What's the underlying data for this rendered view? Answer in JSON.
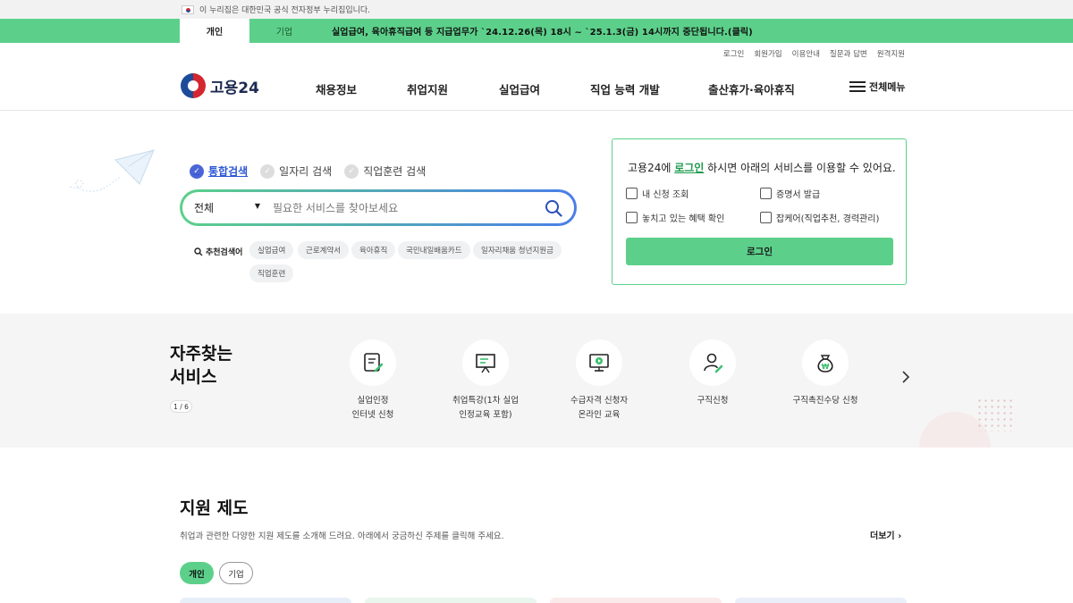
{
  "gov_strip": {
    "text": "이 누리집은 대한민국 공식 전자정부 누리집입니다."
  },
  "notice": {
    "tabs": [
      "개인",
      "기업"
    ],
    "message": "실업급여, 육아휴직급여 등 지급업무가 `24.12.26(목) 18시 ~ `25.1.3(금) 14시까지 중단됩니다.(클릭)"
  },
  "util_links": [
    "로그인",
    "회원가입",
    "이용안내",
    "질문과 답변",
    "원격지원"
  ],
  "header": {
    "logo_text": "고용24",
    "menu": [
      "채용정보",
      "취업지원",
      "실업급여",
      "직업 능력 개발",
      "출산휴가·육아휴직"
    ],
    "all_menu": "전체메뉴"
  },
  "search": {
    "tabs": [
      "통합검색",
      "일자리 검색",
      "직업훈련 검색"
    ],
    "select_value": "전체",
    "placeholder": "필요한 서비스를 찾아보세요",
    "recommend_label": "추천검색어",
    "keywords": [
      "실업급여",
      "근로계약서",
      "육아휴직",
      "국민내일배움카드",
      "일자리채움 청년지원금",
      "직업훈련"
    ]
  },
  "login_card": {
    "title_prefix": "고용24에 ",
    "title_link": "로그인",
    "title_suffix": " 하시면 아래의 서비스를 이용할 수 있어요.",
    "items": [
      "내 신청 조회",
      "증명서 발급",
      "놓치고 있는 혜택 확인",
      "잡케어(직업추천, 경력관리)"
    ],
    "button": "로그인"
  },
  "frequent": {
    "title_line1": "자주찾는",
    "title_line2": "서비스",
    "pager": "1 / 6",
    "services": [
      {
        "label": "실업인정\n인터넷 신청",
        "icon": "document-edit-icon"
      },
      {
        "label": "취업특강(1차 실업\n인정교육 포함)",
        "icon": "presentation-icon"
      },
      {
        "label": "수급자격 신청자\n온라인 교육",
        "icon": "video-monitor-icon"
      },
      {
        "label": "구직신청",
        "icon": "person-edit-icon"
      },
      {
        "label": "구직촉진수당 신청",
        "icon": "money-bag-icon"
      }
    ]
  },
  "support": {
    "title": "지원 제도",
    "desc": "취업과 관련한 다양한 지원 제도를 소개해 드려요. 아래에서 궁금하신 주제를 클릭해 주세요.",
    "more": "더보기",
    "tabs": [
      "개인",
      "기업"
    ]
  },
  "colors": {
    "brand_green": "#5cd08a",
    "brand_blue": "#4a66d6"
  }
}
